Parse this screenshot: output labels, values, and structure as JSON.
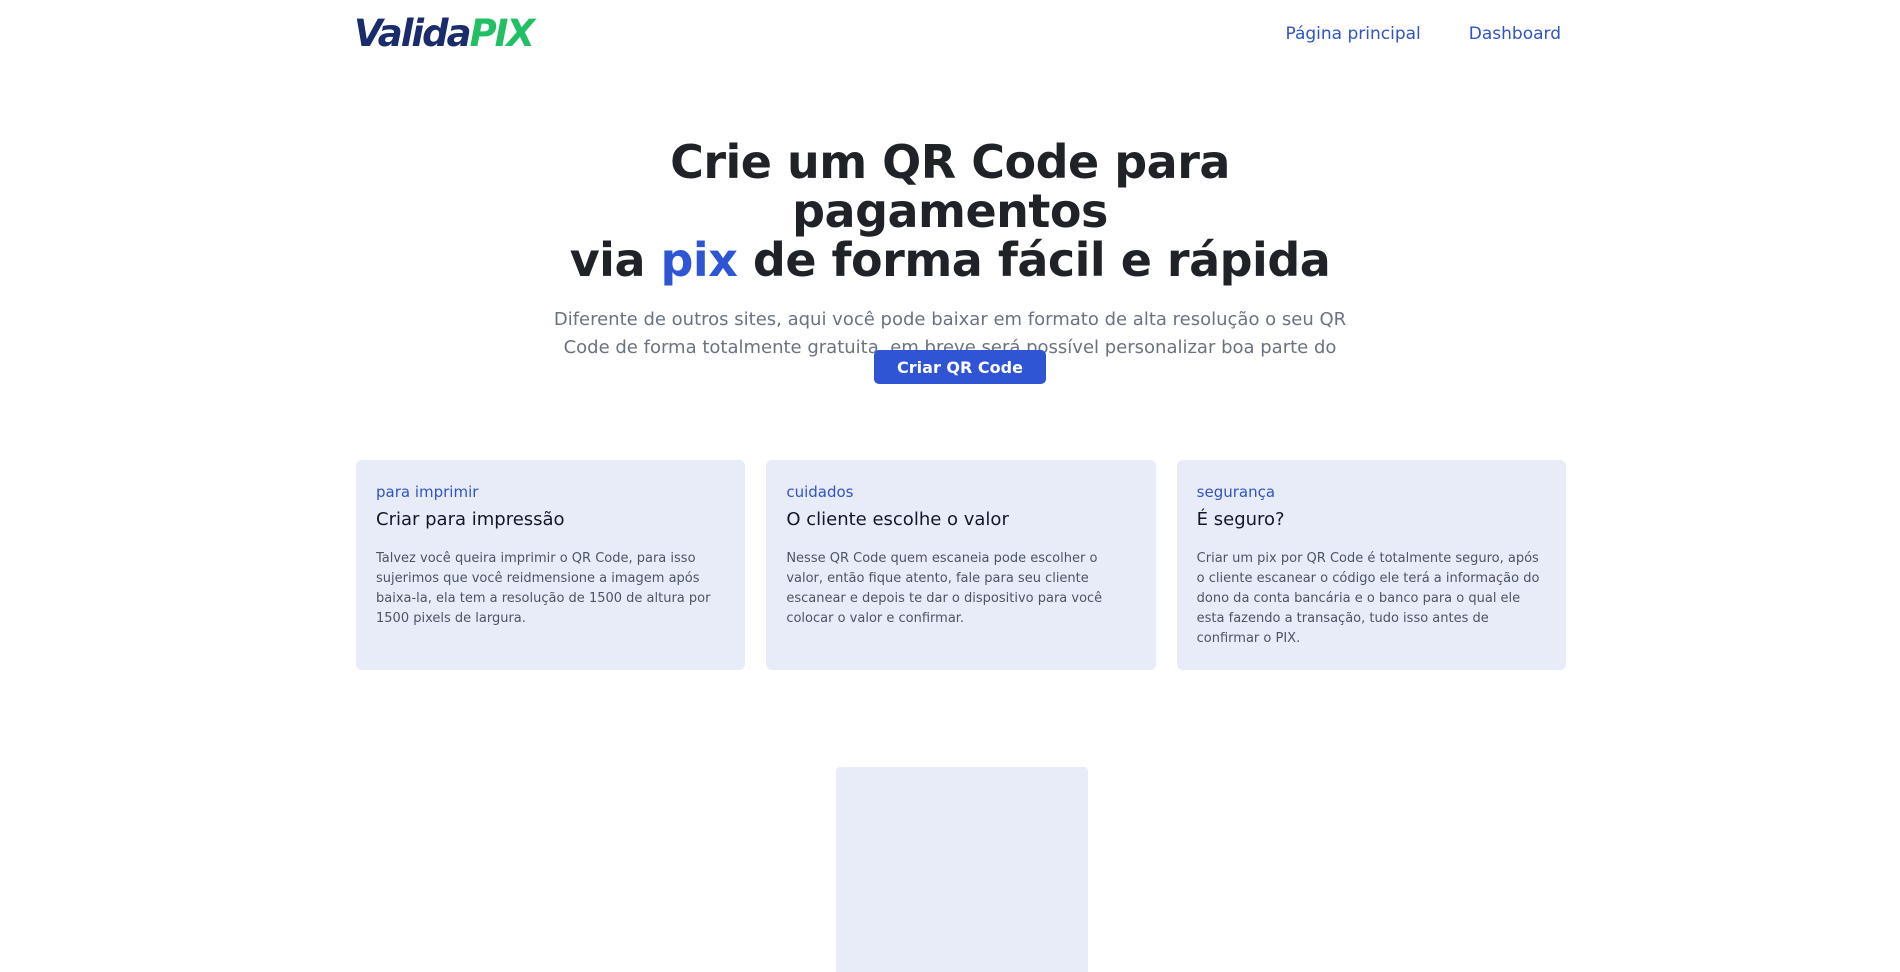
{
  "header": {
    "logo": {
      "part1": "Valida",
      "part2": "PIX"
    },
    "nav": [
      {
        "label": "Página principal"
      },
      {
        "label": "Dashboard"
      }
    ]
  },
  "hero": {
    "title_line1": "Crie um QR Code para pagamentos",
    "title_line2_pre": "via ",
    "title_accent": "pix",
    "title_line2_post": " de forma fácil e rápida",
    "subtitle": "Diferente de outros sites, aqui você pode baixar em formato de alta resolução o seu QR Code de forma totalmente gratuita, em breve será possível personalizar boa parte do QR Code.",
    "cta_label": "Criar QR Code"
  },
  "cards": [
    {
      "kicker": "para imprimir",
      "title": "Criar para impressão",
      "body": "Talvez você queira imprimir o QR Code, para isso sujerimos que você reidmensione a imagem após baixa-la, ela tem a resolução de 1500 de altura por 1500 pixels de largura."
    },
    {
      "kicker": "cuidados",
      "title": "O cliente escolhe o valor",
      "body": "Nesse QR Code quem escaneia pode escolher o valor, então fique atento, fale para seu cliente escanear e depois te dar o dispositivo para você colocar o valor e confirmar."
    },
    {
      "kicker": "segurança",
      "title": "É seguro?",
      "body": "Criar um pix por QR Code é totalmente seguro, após o cliente escanear o código ele terá a informação do dono da conta bancária e o banco para o qual ele esta fazendo a transação, tudo isso antes de confirmar o PIX."
    }
  ],
  "colors": {
    "accent": "#2f54d4",
    "logo_dark": "#1a2c6b",
    "logo_green": "#21c064",
    "card_bg": "#e8ecf8"
  }
}
